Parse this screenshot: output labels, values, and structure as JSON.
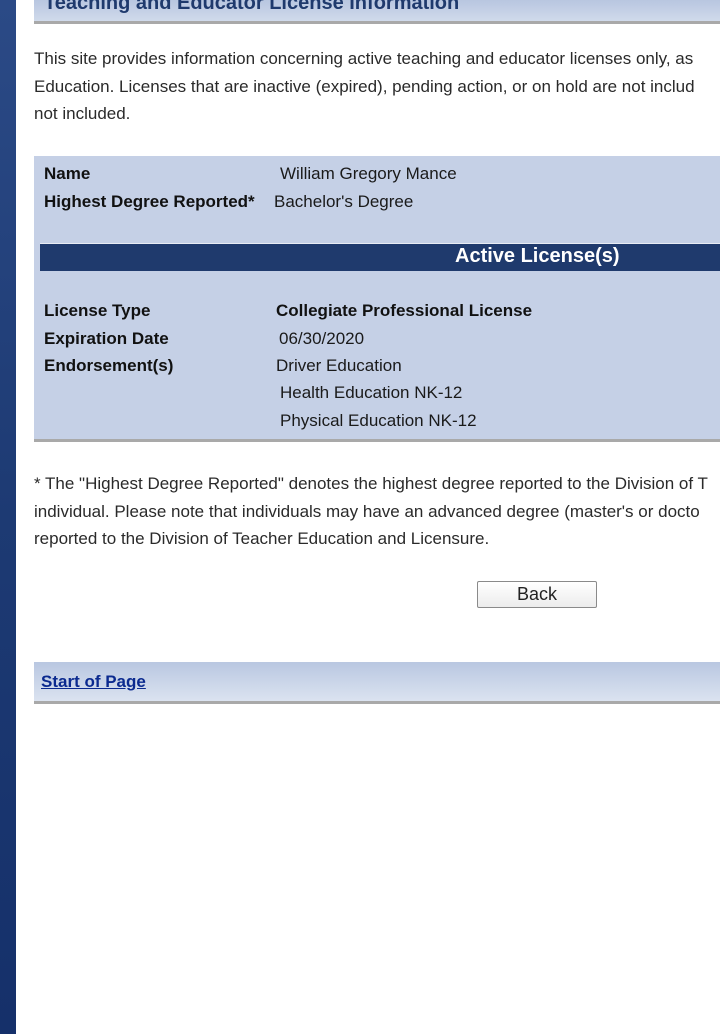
{
  "page": {
    "title": "Teaching and Educator License Information",
    "intro_lines": [
      "This site provides information concerning active teaching and educator licenses only, as",
      "Education.  Licenses that are inactive (expired), pending action, or on hold are not includ",
      "not included."
    ]
  },
  "person": {
    "name_label": "Name",
    "name_value": "William Gregory Mance",
    "degree_label": "Highest Degree Reported*",
    "degree_value": "Bachelor's Degree"
  },
  "active_licenses": {
    "header": "Active License(s)",
    "license_type_label": "License Type",
    "license_type_value": "Collegiate Professional License",
    "expiration_label": "Expiration Date",
    "expiration_value": "06/30/2020",
    "endorsements_label": "Endorsement(s)",
    "endorsements": [
      "Driver Education",
      "Health Education NK-12",
      "Physical Education NK-12"
    ]
  },
  "footnote_lines": [
    "* The \"Highest Degree Reported\" denotes the highest degree reported to the Division of T",
    "individual. Please note that individuals may have an advanced degree (master's or docto",
    "reported to the Division of Teacher Education and Licensure."
  ],
  "actions": {
    "back_label": "Back"
  },
  "footer": {
    "start_of_page_link": "Start of Page"
  },
  "colors": {
    "sidebar": "#1d3a73",
    "panel": "#c5d0e6",
    "active_header": "#1f3a6d",
    "link": "#0b2a8f"
  }
}
